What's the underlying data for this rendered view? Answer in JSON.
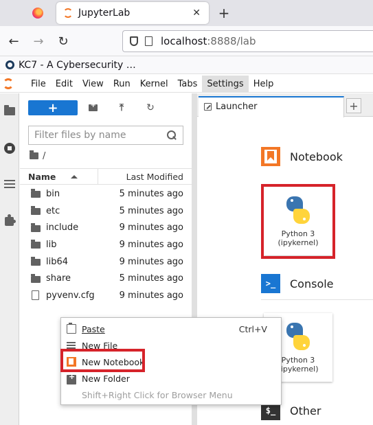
{
  "browser": {
    "tab_title": "JupyterLab",
    "tab_close": "✕",
    "new_tab": "+",
    "url_host": "localhost",
    "url_rest": ":8888/lab",
    "bookmark_label": "KC7 - A Cybersecurity …"
  },
  "menubar": {
    "items": [
      "File",
      "Edit",
      "View",
      "Run",
      "Kernel",
      "Tabs",
      "Settings",
      "Help"
    ],
    "active": "Settings"
  },
  "filebrowser": {
    "new_button": "+",
    "search_placeholder": "Filter files by name",
    "breadcrumb": "/",
    "header_name": "Name",
    "header_modified": "Last Modified",
    "files": [
      {
        "name": "bin",
        "modified": "5 minutes ago",
        "type": "folder"
      },
      {
        "name": "etc",
        "modified": "5 minutes ago",
        "type": "folder"
      },
      {
        "name": "include",
        "modified": "9 minutes ago",
        "type": "folder"
      },
      {
        "name": "lib",
        "modified": "9 minutes ago",
        "type": "folder"
      },
      {
        "name": "lib64",
        "modified": "9 minutes ago",
        "type": "folder"
      },
      {
        "name": "share",
        "modified": "5 minutes ago",
        "type": "folder"
      },
      {
        "name": "pyvenv.cfg",
        "modified": "9 minutes ago",
        "type": "file"
      }
    ]
  },
  "launcher": {
    "tab_label": "Launcher",
    "add_tab": "+",
    "notebook_section": "Notebook",
    "console_section": "Console",
    "other_section": "Other",
    "console_icon_text": ">_",
    "other_icon_text": "$_",
    "notebook_kernel_line1": "Python 3",
    "notebook_kernel_line2": "(ipykernel)",
    "console_kernel_line1": "Python 3",
    "console_kernel_line2": "(ipykernel)"
  },
  "context_menu": {
    "paste": "Paste",
    "paste_shortcut": "Ctrl+V",
    "new_file": "New File",
    "new_notebook": "New Notebook",
    "new_folder": "New Folder",
    "hint": "Shift+Right Click for Browser Menu"
  },
  "colors": {
    "accent_blue": "#1976d2",
    "jupyter_orange": "#f37726",
    "highlight_red": "#d6232a"
  }
}
